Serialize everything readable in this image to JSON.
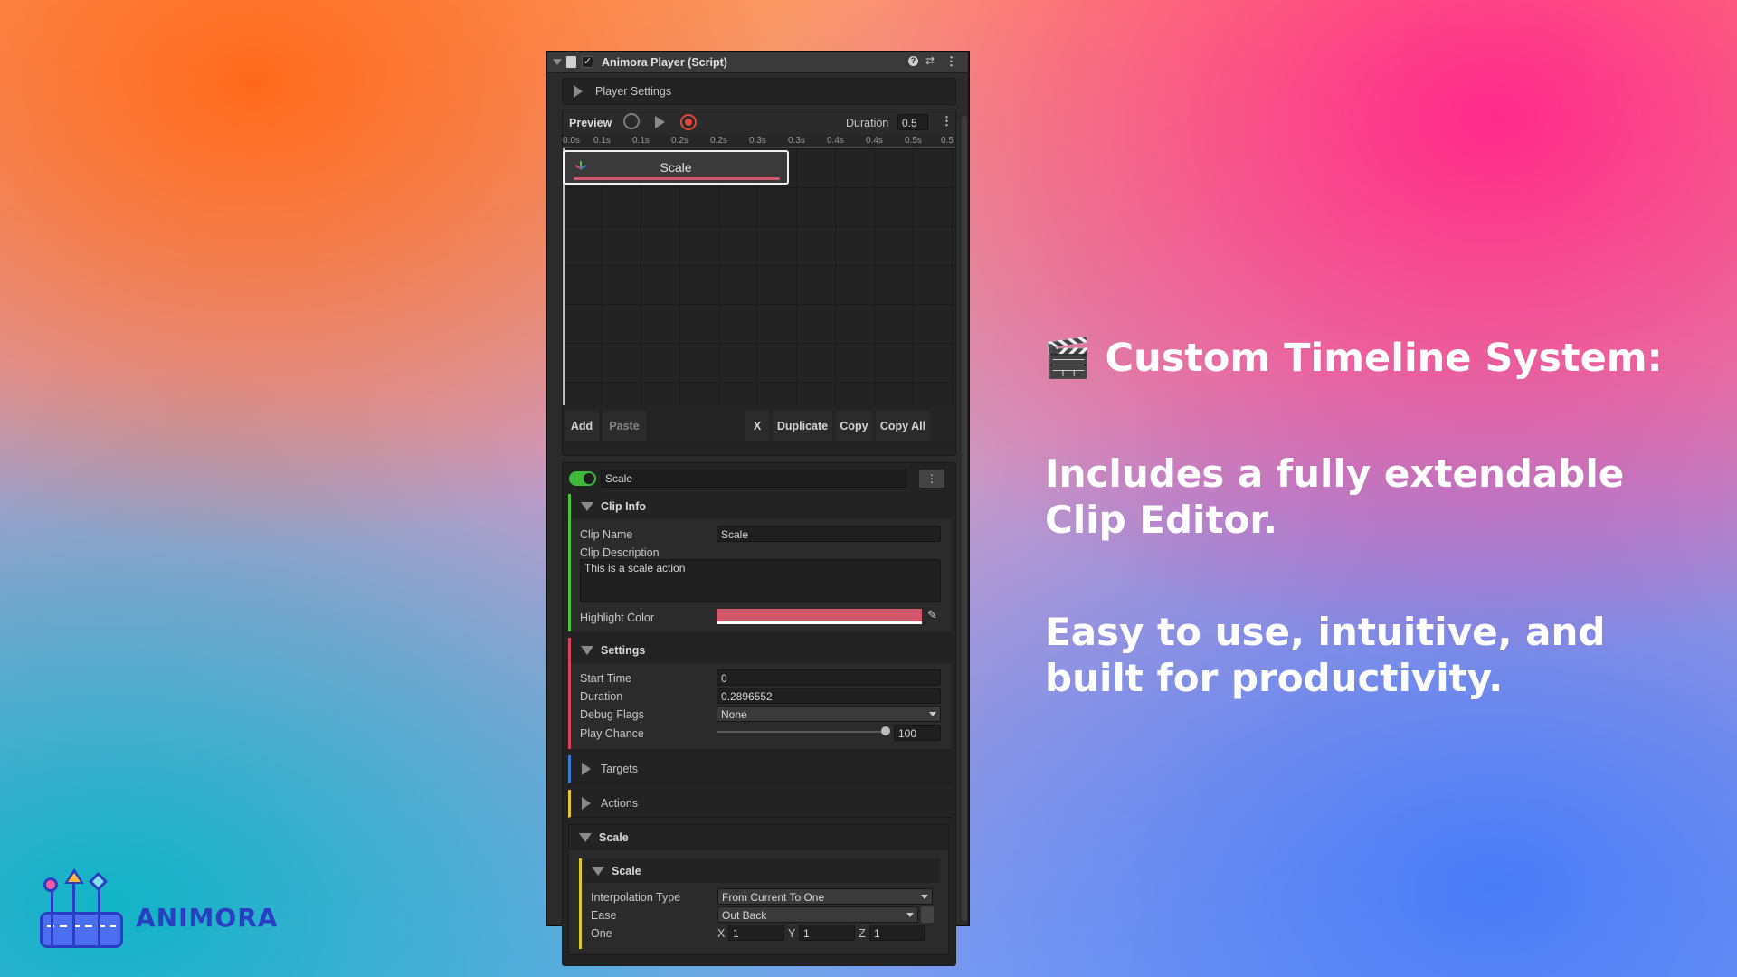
{
  "inspector": {
    "title": "Animora Player (Script)",
    "player_settings_label": "Player Settings",
    "preview": {
      "label": "Preview",
      "duration_label": "Duration",
      "duration_value": "0.5",
      "ticks": [
        "0.0s",
        "0.1s",
        "0.1s",
        "0.2s",
        "0.2s",
        "0.3s",
        "0.3s",
        "0.4s",
        "0.4s",
        "0.5s",
        "0.5"
      ]
    },
    "clip_block_label": "Scale",
    "buttons": {
      "add": "Add",
      "paste": "Paste",
      "delete": "X",
      "duplicate": "Duplicate",
      "copy": "Copy",
      "copy_all": "Copy All"
    },
    "clip_name_field": "Scale",
    "clip_info": {
      "header": "Clip Info",
      "clip_name_label": "Clip Name",
      "clip_name_value": "Scale",
      "clip_description_label": "Clip Description",
      "clip_description_value": "This is a scale action",
      "highlight_color_label": "Highlight Color",
      "highlight_color": "#d2576a"
    },
    "settings": {
      "header": "Settings",
      "start_time_label": "Start Time",
      "start_time_value": "0",
      "duration_label": "Duration",
      "duration_value": "0.2896552",
      "debug_flags_label": "Debug Flags",
      "debug_flags_value": "None",
      "play_chance_label": "Play Chance",
      "play_chance_value": "100",
      "play_chance_fraction": 1.0
    },
    "targets_header": "Targets",
    "actions_header": "Actions",
    "scale_section": {
      "header": "Scale",
      "inner_header": "Scale",
      "interpolation_label": "Interpolation Type",
      "interpolation_value": "From Current To One",
      "ease_label": "Ease",
      "ease_value": "Out Back",
      "one_label": "One",
      "x_label": "X",
      "x_value": "1",
      "y_label": "Y",
      "y_value": "1",
      "z_label": "Z",
      "z_value": "1"
    }
  },
  "hero": {
    "emoji": "🎬",
    "title": "Custom Timeline System:",
    "paragraph1_line1": "Includes a fully extendable",
    "paragraph1_line2": "Clip Editor.",
    "paragraph2_line1": "Easy to use, intuitive, and",
    "paragraph2_line2": "built for productivity."
  },
  "brand": {
    "name": "ANIMORA"
  },
  "colors": {
    "clip_info_accent": "#4cc13a",
    "settings_accent": "#d9445a",
    "targets_accent": "#3a7bd5",
    "actions_accent": "#e0c72c",
    "scale_accent": "#e0c72c",
    "record": "#e0483a",
    "toggle_on": "#3fb93a"
  }
}
